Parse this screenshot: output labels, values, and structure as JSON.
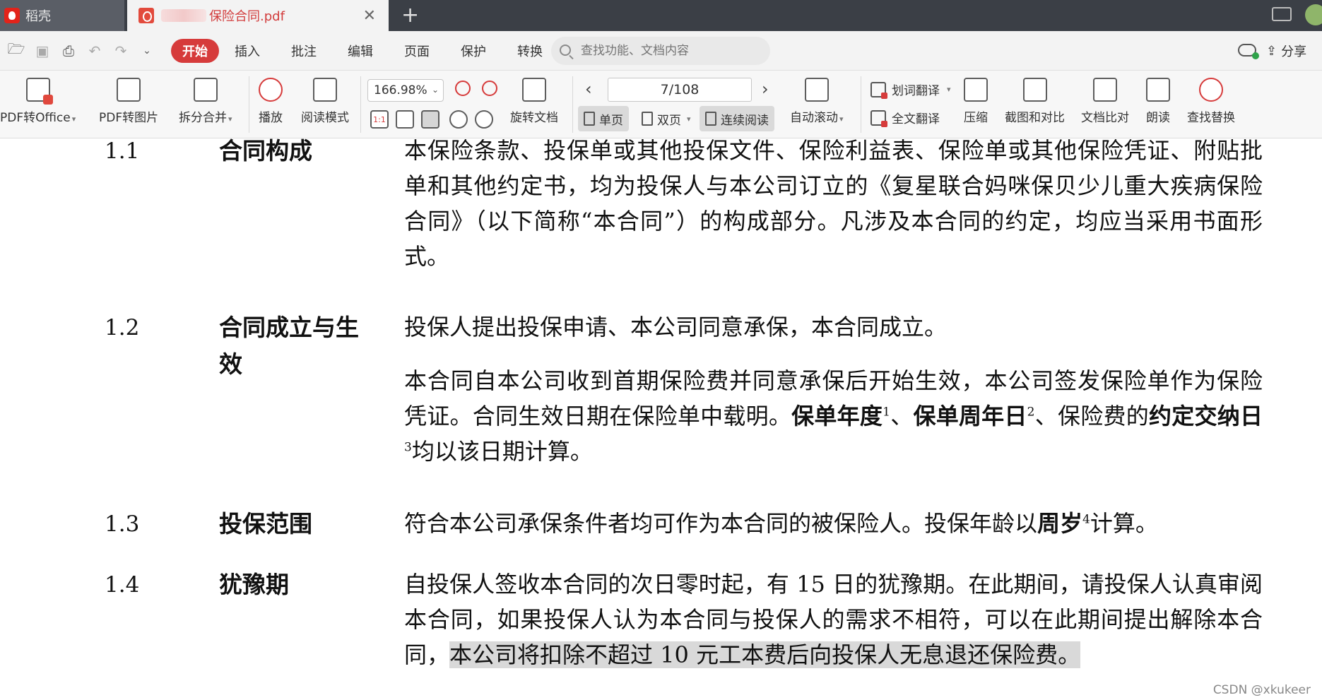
{
  "titlebar": {
    "home_tab": "稻壳",
    "doc_tab": "保险合同.pdf",
    "close_glyph": "✕",
    "add_glyph": "+"
  },
  "menubar": {
    "active": "开始",
    "items": [
      "插入",
      "批注",
      "编辑",
      "页面",
      "保护",
      "转换"
    ],
    "search_placeholder": "查找功能、文档内容",
    "share": "分享"
  },
  "toolbar": {
    "pdf_to_office": "PDF转Office",
    "pdf_to_image": "PDF转图片",
    "split_merge": "拆分合并",
    "play": "播放",
    "read_mode": "阅读模式",
    "zoom": "166.98%",
    "rotate": "旋转文档",
    "page": "7/108",
    "single_page": "单页",
    "double_page": "双页",
    "continuous": "连续阅读",
    "auto_scroll": "自动滚动",
    "word_translate": "划词翻译",
    "full_translate": "全文翻译",
    "compress": "压缩",
    "screenshot_compare": "截图和对比",
    "doc_compare": "文档比对",
    "read_aloud": "朗读",
    "find_replace": "查找替换",
    "prev_glyph": "‹",
    "next_glyph": "›",
    "ratio_label": "1:1"
  },
  "document": {
    "s1": {
      "num": "1.1",
      "title": "合同构成",
      "text": "本保险条款、投保单或其他投保文件、保险利益表、保险单或其他保险凭证、附贴批单和其他约定书，均为投保人与本公司订立的《复星联合妈咪保贝少儿重大疾病保险合同》（以下简称“本合同”）的构成部分。凡涉及本合同的约定，均应当采用书面形式。"
    },
    "s2": {
      "num": "1.2",
      "title": "合同成立与生效",
      "p1": "投保人提出投保申请、本公司同意承保，本合同成立。",
      "p2_a": "本合同自本公司收到首期保险费并同意承保后开始生效，本公司签发保险单作为保险凭证。合同生效日期在保险单中载明。",
      "term1": "保单年度",
      "sup1": "1",
      "sep1": "、",
      "term2": "保单周年日",
      "sup2": "2",
      "p2_b": "、保险费的",
      "term3": "约定交纳日",
      "sup3": "3",
      "p2_c": "均以该日期计算。"
    },
    "s3": {
      "num": "1.3",
      "title": "投保范围",
      "text_a": "符合本公司承保条件者均可作为本合同的被保险人。投保年龄以",
      "term": "周岁",
      "sup": "4",
      "text_b": "计算。"
    },
    "s4": {
      "num": "1.4",
      "title": "犹豫期",
      "text_a": "自投保人签收本合同的次日零时起，有 15 日的犹豫期。在此期间，请投保人认真审阅本合同，如果投保人认为本合同与投保人的需求不相符，可以在此期间提出解除本合同，",
      "text_hl": "本公司将扣除不超过 10 元工本费后向投保人无息退还保险费。"
    }
  },
  "watermark": "CSDN @xkukeer"
}
